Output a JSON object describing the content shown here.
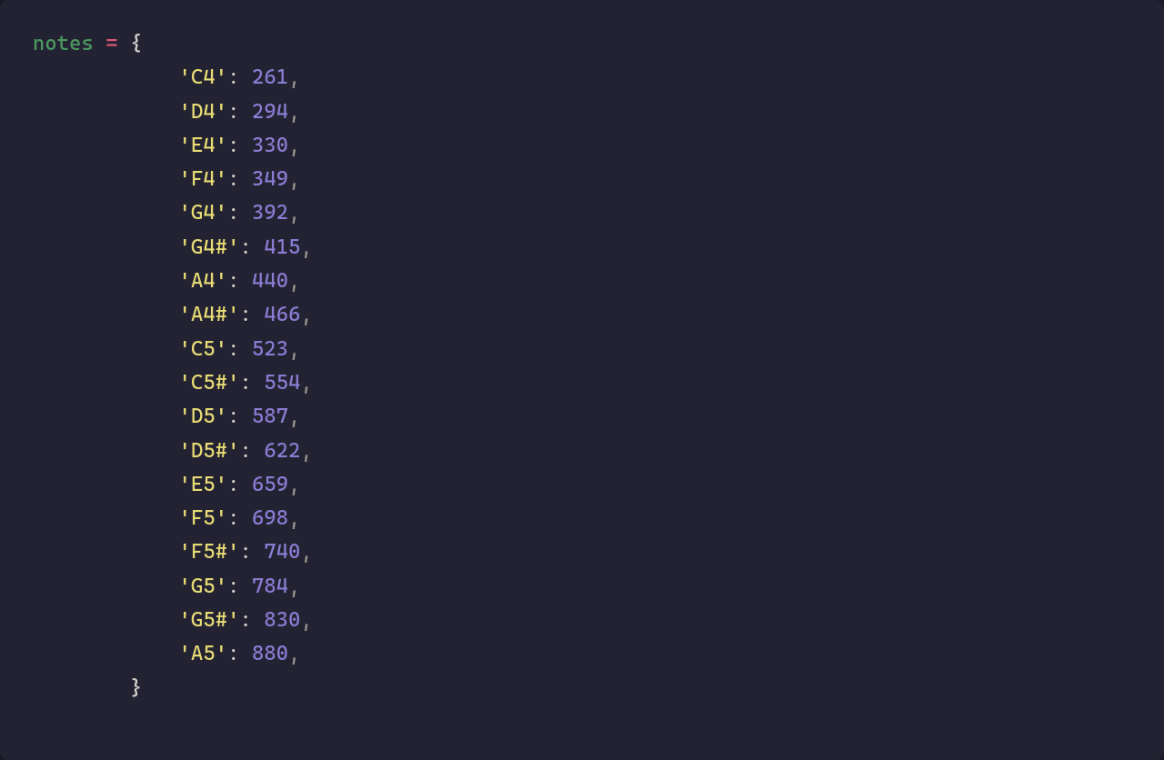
{
  "code": {
    "variable": "notes",
    "operator": "=",
    "open_brace": "{",
    "close_brace": "}",
    "entries": [
      {
        "key": "'C4'",
        "value": "261"
      },
      {
        "key": "'D4'",
        "value": "294"
      },
      {
        "key": "'E4'",
        "value": "330"
      },
      {
        "key": "'F4'",
        "value": "349"
      },
      {
        "key": "'G4'",
        "value": "392"
      },
      {
        "key": "'G4#'",
        "value": "415"
      },
      {
        "key": "'A4'",
        "value": "440"
      },
      {
        "key": "'A4#'",
        "value": "466"
      },
      {
        "key": "'C5'",
        "value": "523"
      },
      {
        "key": "'C5#'",
        "value": "554"
      },
      {
        "key": "'D5'",
        "value": "587"
      },
      {
        "key": "'D5#'",
        "value": "622"
      },
      {
        "key": "'E5'",
        "value": "659"
      },
      {
        "key": "'F5'",
        "value": "698"
      },
      {
        "key": "'F5#'",
        "value": "740"
      },
      {
        "key": "'G5'",
        "value": "784"
      },
      {
        "key": "'G5#'",
        "value": "830"
      },
      {
        "key": "'A5'",
        "value": "880"
      }
    ],
    "indent_first": "        ",
    "indent_entry": "            ",
    "closing_indent": "        "
  }
}
